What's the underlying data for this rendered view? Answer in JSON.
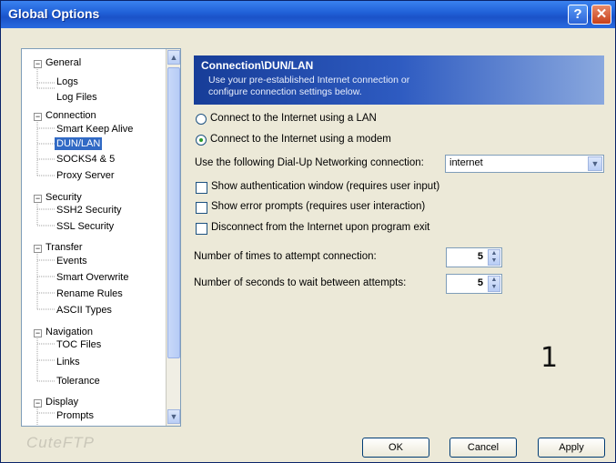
{
  "window": {
    "title": "Global Options"
  },
  "titlebar": {
    "help_glyph": "?",
    "close_glyph": "✕"
  },
  "tree": {
    "items": [
      {
        "label": "General",
        "level": 0,
        "expander": "−"
      },
      {
        "label": "Logs",
        "level": 1
      },
      {
        "label": "Log Files",
        "level": 1
      },
      {
        "label": "Connection",
        "level": 0,
        "expander": "−"
      },
      {
        "label": "Smart Keep Alive",
        "level": 1
      },
      {
        "label": "DUN/LAN",
        "level": 1,
        "selected": true
      },
      {
        "label": "SOCKS4 & 5",
        "level": 1
      },
      {
        "label": "Proxy Server",
        "level": 1
      },
      {
        "label": "Security",
        "level": 0,
        "expander": "−"
      },
      {
        "label": "SSH2 Security",
        "level": 1
      },
      {
        "label": "SSL Security",
        "level": 1
      },
      {
        "label": "Transfer",
        "level": 0,
        "expander": "−"
      },
      {
        "label": "Events",
        "level": 1
      },
      {
        "label": "Smart Overwrite",
        "level": 1
      },
      {
        "label": "Rename Rules",
        "level": 1
      },
      {
        "label": "ASCII Types",
        "level": 1
      },
      {
        "label": "Navigation",
        "level": 0,
        "expander": "−"
      },
      {
        "label": "TOC Files",
        "level": 1
      },
      {
        "label": "Links",
        "level": 1
      },
      {
        "label": "Tolerance",
        "level": 1
      },
      {
        "label": "Display",
        "level": 0,
        "expander": "−"
      },
      {
        "label": "Prompts",
        "level": 1
      }
    ]
  },
  "header": {
    "title": "Connection\\DUN/LAN",
    "desc_line1": "Use your pre-established Internet connection or",
    "desc_line2": "configure connection settings below."
  },
  "options": {
    "radio_lan": "Connect to the Internet using a LAN",
    "radio_modem": "Connect to the Internet using a modem",
    "dialup_label": "Use the following Dial-Up Networking connection:",
    "dialup_value": "internet",
    "check_auth": "Show authentication window (requires user input)",
    "check_errors": "Show error prompts (requires user interaction)",
    "check_disconnect": "Disconnect from the Internet upon program exit",
    "attempts_label": "Number of times to attempt connection:",
    "attempts_value": "5",
    "wait_label": "Number of seconds to wait between attempts:",
    "wait_value": "5"
  },
  "annotation": "1",
  "footer": {
    "logo": "CuteFTP",
    "ok": "OK",
    "cancel": "Cancel",
    "apply": "Apply"
  }
}
